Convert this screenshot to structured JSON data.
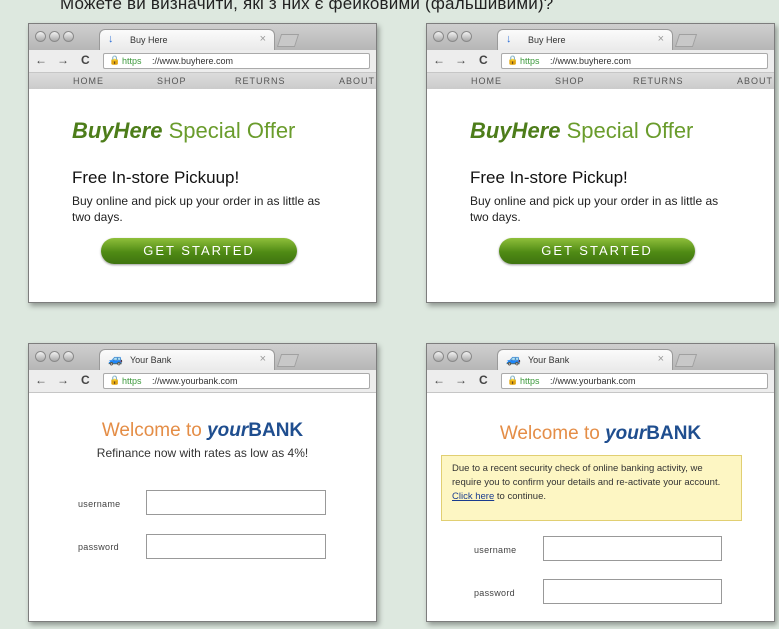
{
  "caption": "Можете ви визначити, які з них є фейковими (фальшивими)?",
  "buyhere": {
    "tab_title": "Buy Here",
    "url_https": "https",
    "url_left": "://www.buyhere.com",
    "url_right": "://www.buyhere.com",
    "menu": [
      "HOME",
      "SHOP",
      "RETURNS",
      "ABOUT"
    ],
    "offer_brand": "BuyHere",
    "offer_rest": "Special Offer",
    "pickup_left": "Free In-store Pickuup!",
    "pickup_right": "Free In-store Pickup!",
    "blurb": "Buy online and pick up your order in as little as two days.",
    "cta": "GET STARTED"
  },
  "bank": {
    "tab_title": "Your Bank",
    "url_https": "https",
    "url_left": "://www.yourbank.com",
    "url_right": "://www.yourbank.com",
    "welcome": "Welcome to ",
    "your": "your",
    "bank": "BANK",
    "refinance": "Refinance now with rates as low as 4%!",
    "username_label": "username",
    "password_label": "password",
    "notice_text": "Due to a recent security check of online banking activity, we require you to confirm your details and re-activate your account.",
    "notice_link": "Click here",
    "notice_tail": " to continue."
  },
  "nav": {
    "back": "←",
    "forward": "→",
    "reload": "C"
  },
  "colors": {
    "background": "#dde8df",
    "cta_green": "#4f8a14",
    "bank_blue": "#1f4e8f",
    "welcome_orange": "#e48d46"
  }
}
